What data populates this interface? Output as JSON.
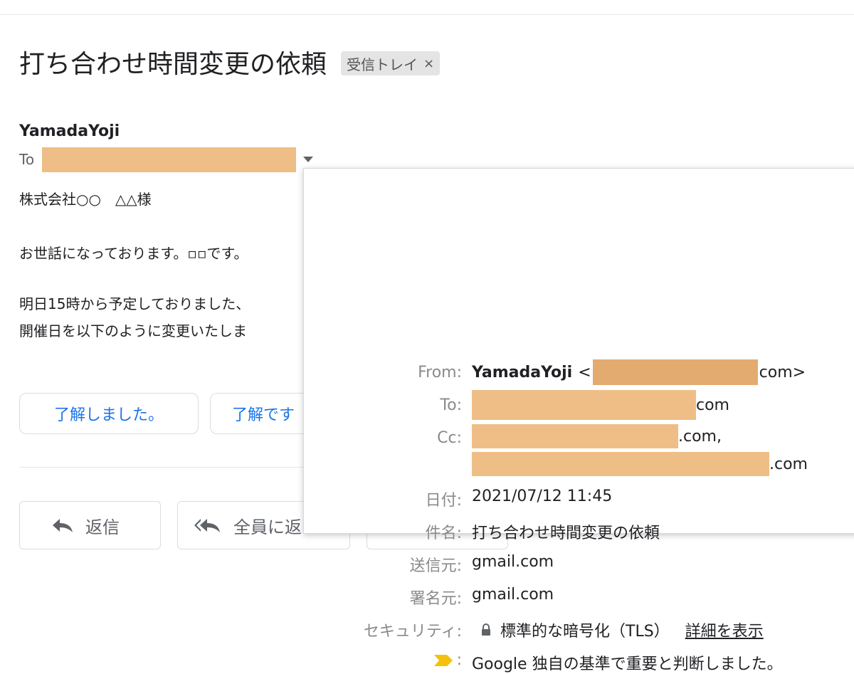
{
  "subject": "打ち合わせ時間変更の依頼",
  "label_chip": {
    "text": "受信トレイ",
    "close": "×"
  },
  "sender": "YamadaYoji",
  "to_label": "To",
  "body": {
    "greeting": "株式会社○○　△△様",
    "line1": "お世話になっております。▫▫です。",
    "line2": "明日15時から予定しておりました、",
    "line3": "開催日を以下のように変更いたしま"
  },
  "smart_replies": [
    "了解しました。",
    "了解です"
  ],
  "actions": {
    "reply": "返信",
    "reply_all": "全員に返"
  },
  "details": {
    "from_label": "From:",
    "from_name": "YamadaYoji",
    "from_prefix": "<",
    "from_suffix": "com>",
    "to_label": "To:",
    "to_suffix": "com",
    "cc_label": "Cc:",
    "cc_suffix1": ".com,",
    "cc_suffix2": ".com",
    "date_label": "日付:",
    "date": "2021/07/12 11:45",
    "subject_label": "件名:",
    "subject": "打ち合わせ時間変更の依頼",
    "mailed_by_label": "送信元:",
    "mailed_by": "gmail.com",
    "signed_by_label": "署名元:",
    "signed_by": "gmail.com",
    "security_label": "セキュリティ:",
    "security": "標準的な暗号化（TLS）",
    "security_link": "詳細を表示",
    "importance_label": ":",
    "importance": "Google 独自の基準で重要と判断しました。"
  },
  "colors": {
    "redaction": "#efbe86",
    "link_blue": "#1a73e8",
    "importance_marker": "#f4c20d"
  }
}
